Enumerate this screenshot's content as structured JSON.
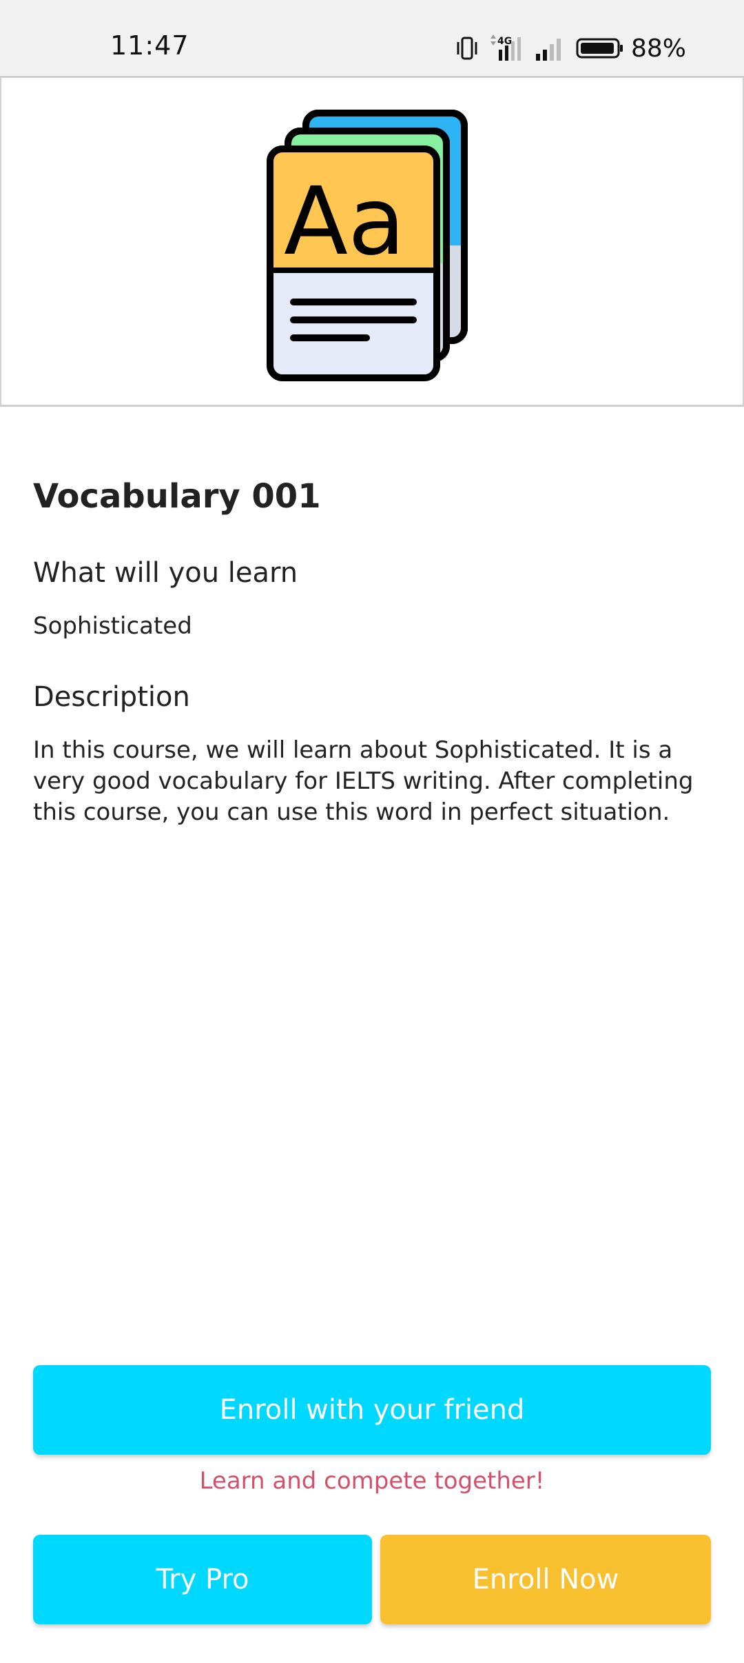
{
  "status_bar": {
    "time": "11:47",
    "network": "4G",
    "battery": "88%",
    "icons": [
      "vibrate-icon",
      "data-arrows-icon",
      "signal-icon",
      "signal-icon",
      "battery-icon"
    ]
  },
  "hero": {
    "icon": "vocabulary-cards-icon",
    "card_text": "Aa",
    "colors": {
      "front": "#FFC751",
      "middle": "#86F0A0",
      "back": "#2EB4F5",
      "lower": "#E4EAF7"
    }
  },
  "course": {
    "title": "Vocabulary 001",
    "learn_heading": "What will you learn",
    "learn_value": "Sophisticated",
    "description_heading": "Description",
    "description": "In this course, we will learn about Sophisticated. It is a very good vocabulary for IELTS writing. After completing this course, you can use this word in perfect situation."
  },
  "actions": {
    "enroll_friend_label": "Enroll with your friend",
    "tagline": "Learn and compete together!",
    "try_pro_label": "Try Pro",
    "enroll_now_label": "Enroll Now"
  },
  "colors": {
    "accent": "#00D8FF",
    "enroll_now": "#F8C02F",
    "tagline": "#D4506A"
  }
}
